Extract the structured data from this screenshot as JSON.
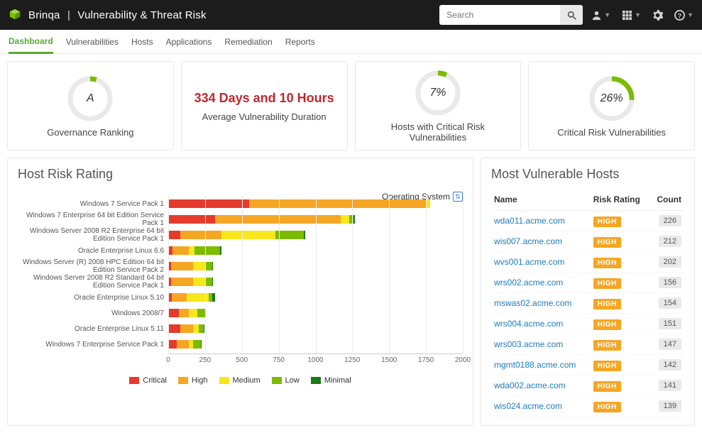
{
  "topbar": {
    "brand_left": "Brinqa",
    "brand_right": "Vulnerability & Threat Risk",
    "search_placeholder": "Search"
  },
  "tabs": [
    "Dashboard",
    "Vulnerabilities",
    "Hosts",
    "Applications",
    "Remediation",
    "Reports"
  ],
  "cards": {
    "governance": {
      "value": "A",
      "label": "Governance Ranking",
      "pct": 5
    },
    "avg_duration": {
      "value": "334 Days and 10 Hours",
      "label": "Average Vulnerability Duration"
    },
    "hosts_critical": {
      "value": "7%",
      "label": "Hosts with Critical Risk Vulnerabilities",
      "pct": 7
    },
    "critical_vulns": {
      "value": "26%",
      "label": "Critical Risk Vulnerabilities",
      "pct": 26
    }
  },
  "chart": {
    "title": "Host Risk Rating",
    "group_by_label": "Operating System"
  },
  "chart_data": {
    "type": "bar",
    "orientation": "horizontal",
    "stacked": true,
    "xlabel": "",
    "ylabel": "",
    "xlim": [
      0,
      2000
    ],
    "xticks": [
      0,
      250,
      500,
      750,
      1000,
      1250,
      1500,
      1750,
      2000
    ],
    "legend": [
      "Critical",
      "High",
      "Medium",
      "Low",
      "Minimal"
    ],
    "colors": {
      "Critical": "#e43b2c",
      "High": "#f5a623",
      "Medium": "#f8e71c",
      "Low": "#7cbb00",
      "Minimal": "#1b7a1b"
    },
    "categories": [
      "Windows 7 Service Pack 1",
      "Windows 7 Enterprise 64 bit Edition Service Pack 1",
      "Windows Server 2008 R2 Enterprise 64 bit Edition Service Pack 1",
      "Oracle Enterprise Linux 6.6",
      "Windows Server (R) 2008 HPC Edition 64 bit Edition Service Pack 2",
      "Windows Server 2008 R2 Standard 64 bit Edition Service Pack 1",
      "Oracle Enterprise Linux 5.10",
      "Windows 2008/7",
      "Oracle Enterprise Linux 5.11",
      "Windows 7 Enterprise Service Pack 1"
    ],
    "series": [
      {
        "name": "Critical",
        "values": [
          550,
          320,
          80,
          30,
          20,
          20,
          25,
          70,
          80,
          60
        ]
      },
      {
        "name": "High",
        "values": [
          1200,
          850,
          280,
          110,
          150,
          150,
          100,
          70,
          90,
          80
        ]
      },
      {
        "name": "Medium",
        "values": [
          30,
          60,
          370,
          40,
          80,
          80,
          150,
          60,
          35,
          30
        ]
      },
      {
        "name": "Low",
        "values": [
          0,
          30,
          190,
          170,
          50,
          50,
          25,
          50,
          35,
          50
        ]
      },
      {
        "name": "Minimal",
        "values": [
          0,
          10,
          10,
          10,
          5,
          5,
          20,
          5,
          5,
          5
        ]
      }
    ]
  },
  "host_table": {
    "title": "Most Vulnerable Hosts",
    "columns": [
      "Name",
      "Risk Rating",
      "Count"
    ],
    "rows": [
      {
        "name": "wda011.acme.com",
        "rating": "HIGH",
        "count": 226
      },
      {
        "name": "wis007.acme.com",
        "rating": "HIGH",
        "count": 212
      },
      {
        "name": "wvs001.acme.com",
        "rating": "HIGH",
        "count": 202
      },
      {
        "name": "wrs002.acme.com",
        "rating": "HIGH",
        "count": 156
      },
      {
        "name": "mswas02.acme.com",
        "rating": "HIGH",
        "count": 154
      },
      {
        "name": "wrs004.acme.com",
        "rating": "HIGH",
        "count": 151
      },
      {
        "name": "wrs003.acme.com",
        "rating": "HIGH",
        "count": 147
      },
      {
        "name": "mgmt0188.acme.com",
        "rating": "HIGH",
        "count": 142
      },
      {
        "name": "wda002.acme.com",
        "rating": "HIGH",
        "count": 141
      },
      {
        "name": "wis024.acme.com",
        "rating": "HIGH",
        "count": 139
      }
    ]
  }
}
